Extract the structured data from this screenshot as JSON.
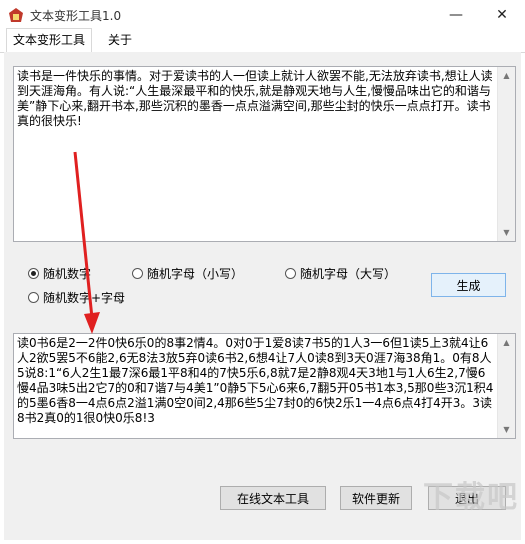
{
  "window": {
    "title": "文本变形工具1.0",
    "minimize_icon": "minimize-icon",
    "close_icon": "close-icon"
  },
  "tabs": [
    {
      "label": "文本变形工具",
      "active": true
    },
    {
      "label": "关于",
      "active": false
    }
  ],
  "input_text": "读书是一件快乐的事情。对于爱读书的人一但读上就计人欲罢不能,无法放弃读书,想让人读到天涯海角。有人说:“人生最深最平和的快乐,就是静观天地与人生,慢慢品味出它的和谐与美”静下心来,翻开书本,那些沉积的墨香一点点溢满空间,那些尘封的快乐一点点打开。读书真的很快乐!",
  "options": [
    {
      "label": "随机数字",
      "checked": true
    },
    {
      "label": "随机字母（小写）",
      "checked": false
    },
    {
      "label": "随机字母（大写）",
      "checked": false
    },
    {
      "label": "随机数字+字母",
      "checked": false
    }
  ],
  "generate_label": "生成",
  "output_text": "读0书6是2一2件0快6乐0的8事2情4。0对0于1爱8读7书5的1人3一6但1读5上3就4让6人2欲5罢5不6能2,6无8法3放5弃0读6书2,6想4让7人0读8到3天0涯7海38角1。0有8人5说8:1“6人2生1最7深6最1平8和4的7快5乐6,8就7是2静8观4天3地1与1人6生2,7慢6慢4品3味5出2它7的0和7谐7与4美1”0静5下5心6来6,7翻5开05书1本3,5那0些3沉1积4的5墨6香8一4点6点2溢1满0空0间2,4那6些5尘7封0的6快2乐1一4点6点4打4开3。3读8书2真0的1很0快0乐8!3",
  "bottom_buttons": [
    "在线文本工具",
    "软件更新",
    "退出"
  ],
  "watermark": "下载吧",
  "accent_arrow_color": "#e02020"
}
